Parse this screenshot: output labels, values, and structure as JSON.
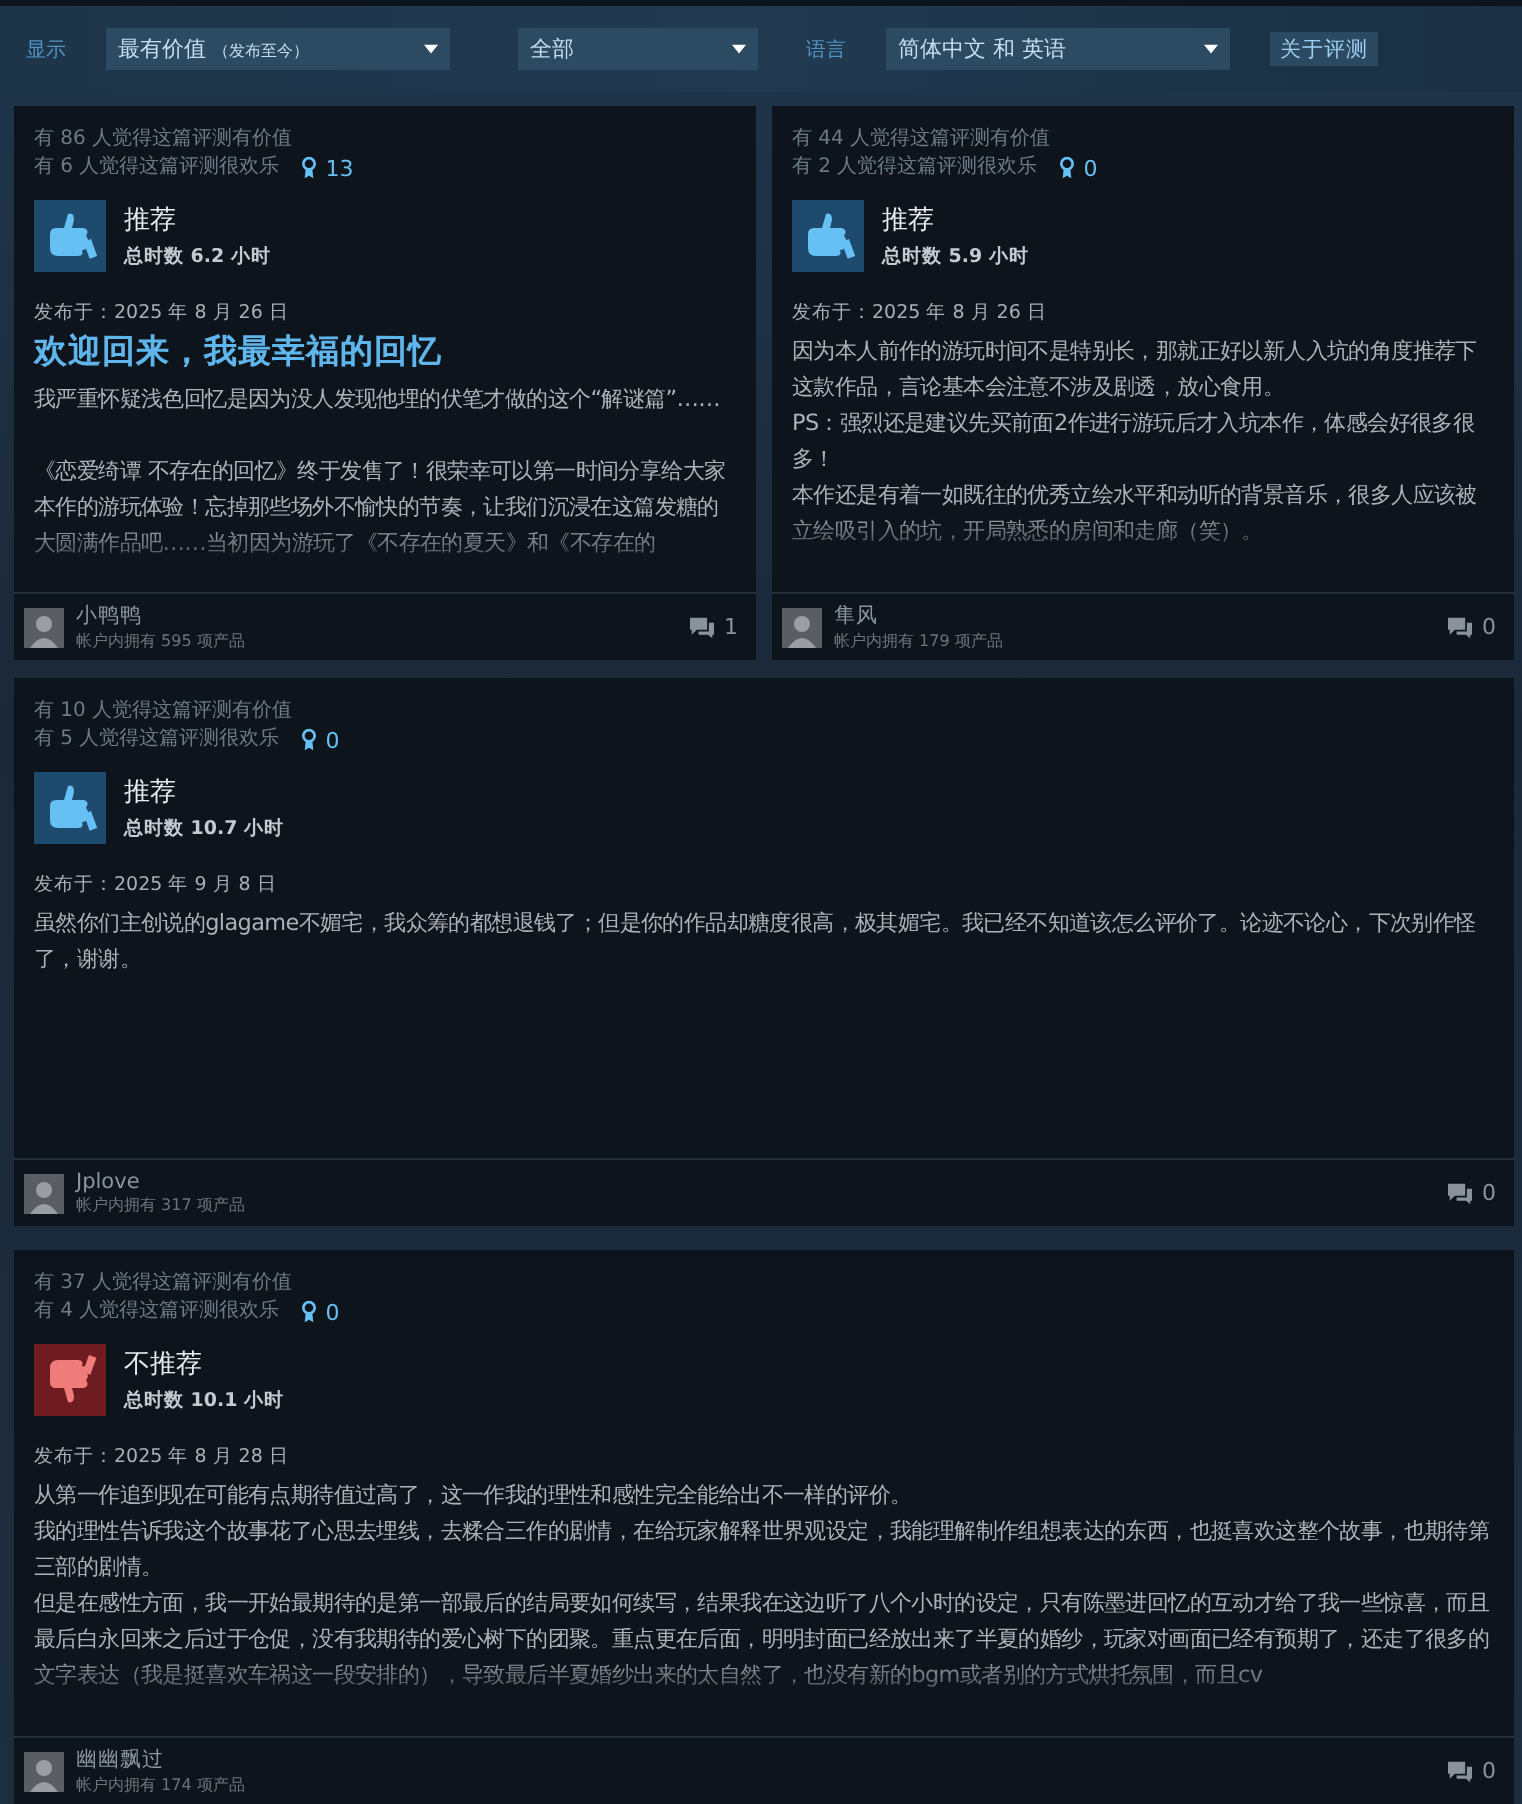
{
  "filters": {
    "display_label": "显示",
    "sort": "最有价值",
    "sort_note": "（发布至今）",
    "type": "全部",
    "language_label": "语言",
    "language": "简体中文 和 英语",
    "about_button": "关于评测"
  },
  "reviews": [
    {
      "helpful": "有 86 人觉得这篇评测有价值",
      "funny": "有 6 人觉得这篇评测很欢乐",
      "awards": "13",
      "recommended": true,
      "verdict": "推荐",
      "hours": "总时数 6.2 小时",
      "date": "发布于：2025 年 8 月 26 日",
      "title": "欢迎回来，我最幸福的回忆",
      "paragraphs": [
        "我严重怀疑浅色回忆是因为没人发现他埋的伏笔才做的这个“解谜篇”……\n\n《恋爱绮谭 不存在的回忆》终于发售了！很荣幸可以第一时间分享给大家本作的游玩体验！忘掉那些场外不愉快的节奏，让我们沉浸在这篇发糖的大圆满作品吧……当初因为游玩了《不存在的夏天》和《不存在的"
      ],
      "truncated": true,
      "author": "小鸭鸭",
      "products": "帐户内拥有 595 项产品",
      "comments": "1"
    },
    {
      "helpful": "有 44 人觉得这篇评测有价值",
      "funny": "有 2 人觉得这篇评测很欢乐",
      "awards": "0",
      "recommended": true,
      "verdict": "推荐",
      "hours": "总时数 5.9 小时",
      "date": "发布于：2025 年 8 月 26 日",
      "paragraphs": [
        "因为本人前作的游玩时间不是特别长，那就正好以新人入坑的角度推荐下这款作品，言论基本会注意不涉及剧透，放心食用。",
        "PS：强烈还是建议先买前面2作进行游玩后才入坑本作，体感会好很多很多！",
        "本作还是有着一如既往的优秀立绘水平和动听的背景音乐，很多人应该被立绘吸引入的坑，开局熟悉的房间和走廊（笑）。"
      ],
      "truncated": true,
      "author": "隼风",
      "products": "帐户内拥有 179 项产品",
      "comments": "0"
    },
    {
      "helpful": "有 10 人觉得这篇评测有价值",
      "funny": "有 5 人觉得这篇评测很欢乐",
      "awards": "0",
      "recommended": true,
      "verdict": "推荐",
      "hours": "总时数 10.7 小时",
      "date": "发布于：2025 年 9 月 8 日",
      "paragraphs": [
        "虽然你们主创说的glagame不媚宅，我众筹的都想退钱了；但是你的作品却糖度很高，极其媚宅。我已经不知道该怎么评价了。论迹不论心，下次别作怪了，谢谢。"
      ],
      "truncated": false,
      "author": "Jplove",
      "products": "帐户内拥有 317 项产品",
      "comments": "0"
    },
    {
      "helpful": "有 37 人觉得这篇评测有价值",
      "funny": "有 4 人觉得这篇评测很欢乐",
      "awards": "0",
      "recommended": false,
      "verdict": "不推荐",
      "hours": "总时数 10.1 小时",
      "date": "发布于：2025 年 8 月 28 日",
      "paragraphs": [
        "从第一作追到现在可能有点期待值过高了，这一作我的理性和感性完全能给出不一样的评价。",
        "我的理性告诉我这个故事花了心思去埋线，去糅合三作的剧情，在给玩家解释世界观设定，我能理解制作组想表达的东西，也挺喜欢这整个故事，也期待第三部的剧情。",
        "但是在感性方面，我一开始最期待的是第一部最后的结局要如何续写，结果我在这边听了八个小时的设定，只有陈墨进回忆的互动才给了我一些惊喜，而且最后白永回来之后过于仓促，没有我期待的爱心树下的团聚。重点更在后面，明明封面已经放出来了半夏的婚纱，玩家对画面已经有预期了，还走了很多的文字表达（我是挺喜欢车祸这一段安排的），导致最后半夏婚纱出来的太自然了，也没有新的bgm或者别的方式烘托氛围，而且cv"
      ],
      "truncated": true,
      "author": "幽幽飘过",
      "products": "帐户内拥有 174 项产品",
      "comments": "0"
    }
  ]
}
